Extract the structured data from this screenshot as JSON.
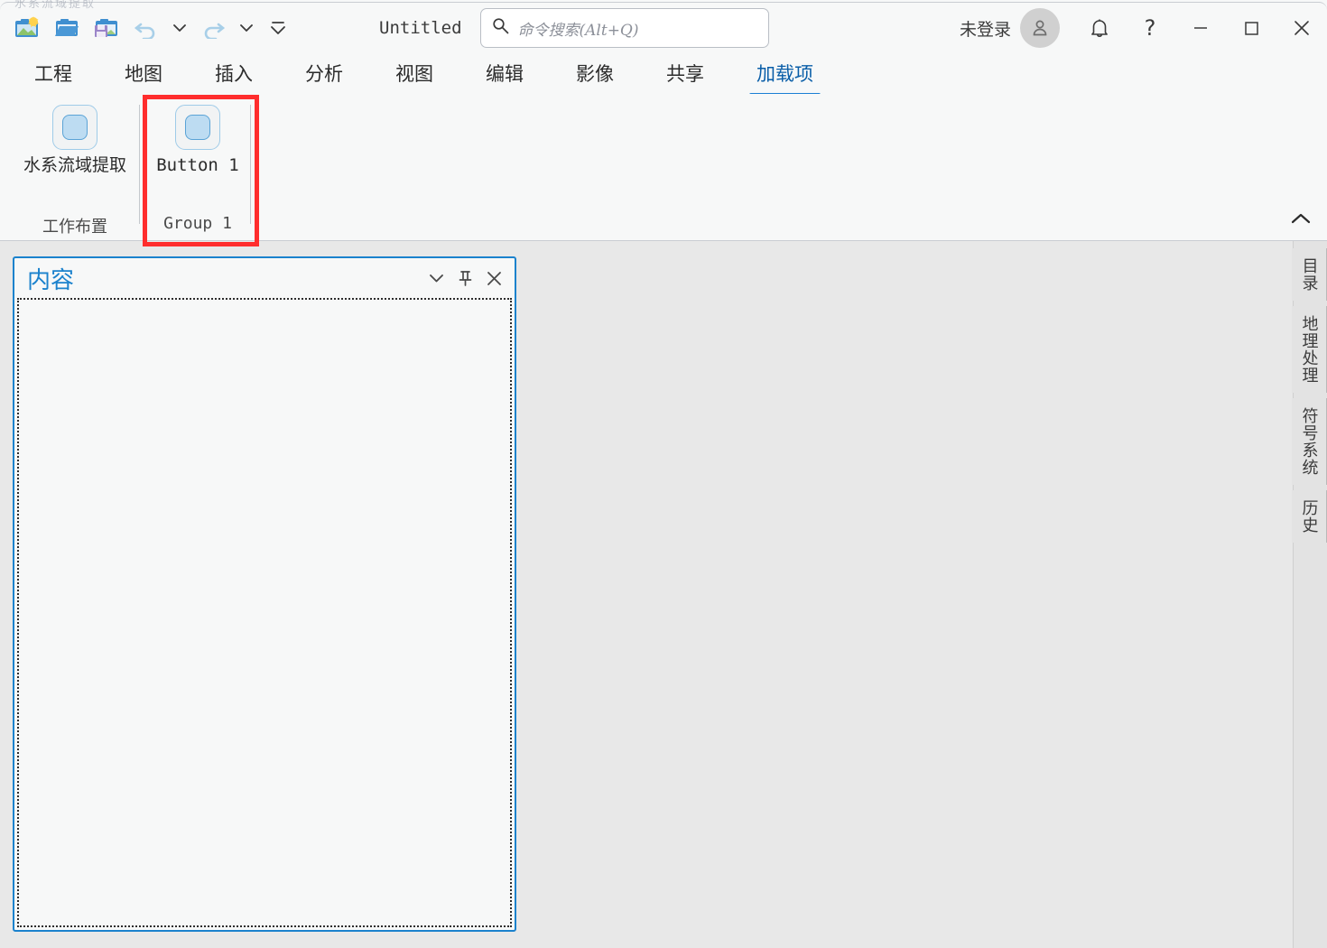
{
  "window": {
    "title": "Untitled",
    "ghost_text": "水系流域提取"
  },
  "quick_access": {
    "items": [
      {
        "name": "new-project-icon",
        "label": "新建工程"
      },
      {
        "name": "open-project-icon",
        "label": "打开工程"
      },
      {
        "name": "save-project-icon",
        "label": "保存工程"
      },
      {
        "name": "undo-icon",
        "label": "撤销"
      },
      {
        "name": "undo-dropdown-icon",
        "label": "撤销下拉"
      },
      {
        "name": "redo-icon",
        "label": "恢复"
      },
      {
        "name": "redo-dropdown-icon",
        "label": "恢复下拉"
      },
      {
        "name": "customize-qat-icon",
        "label": "自定义快速访问工具栏"
      }
    ]
  },
  "search": {
    "placeholder": "命令搜索(Alt+Q)",
    "value": "",
    "icon": "search-icon"
  },
  "account": {
    "label": "未登录",
    "avatar_icon": "user-icon"
  },
  "titlebar_actions": {
    "notifications": "bell-icon",
    "help": "?",
    "minimize": "minimize-icon",
    "maximize": "maximize-icon",
    "close": "close-icon"
  },
  "ribbon": {
    "tabs": [
      {
        "label": "工程",
        "active": false
      },
      {
        "label": "地图",
        "active": false
      },
      {
        "label": "插入",
        "active": false
      },
      {
        "label": "分析",
        "active": false
      },
      {
        "label": "视图",
        "active": false
      },
      {
        "label": "编辑",
        "active": false
      },
      {
        "label": "影像",
        "active": false
      },
      {
        "label": "共享",
        "active": false
      },
      {
        "label": "加载项",
        "active": true
      }
    ],
    "groups": [
      {
        "group_label": "工作布置",
        "items": [
          {
            "label": "水系流域提取",
            "icon": "rounded-square-icon"
          }
        ]
      },
      {
        "group_label": "Group 1",
        "items": [
          {
            "label": "Button 1",
            "icon": "rounded-square-icon"
          }
        ]
      }
    ],
    "collapse_icon": "chevron-up-icon"
  },
  "annotation": {
    "color": "#ff2d2d",
    "target": "Group 1"
  },
  "contents_pane": {
    "title": "内容",
    "actions": [
      {
        "name": "pane-menu-icon",
        "glyph": "chevron-down-icon"
      },
      {
        "name": "pane-pin-icon",
        "glyph": "pin-icon"
      },
      {
        "name": "pane-close-icon",
        "glyph": "close-icon"
      }
    ],
    "body_items": []
  },
  "dock_tabs": [
    {
      "label": "目录"
    },
    {
      "label": "地理处理"
    },
    {
      "label": "符号系统"
    },
    {
      "label": "历史"
    }
  ],
  "colors": {
    "accent": "#1b82cd",
    "tab_underline": "#1b7fd4",
    "annotation_red": "#ff2d2d",
    "main_bg": "#e8e8e8",
    "chrome_bg": "#f7f8f8"
  }
}
